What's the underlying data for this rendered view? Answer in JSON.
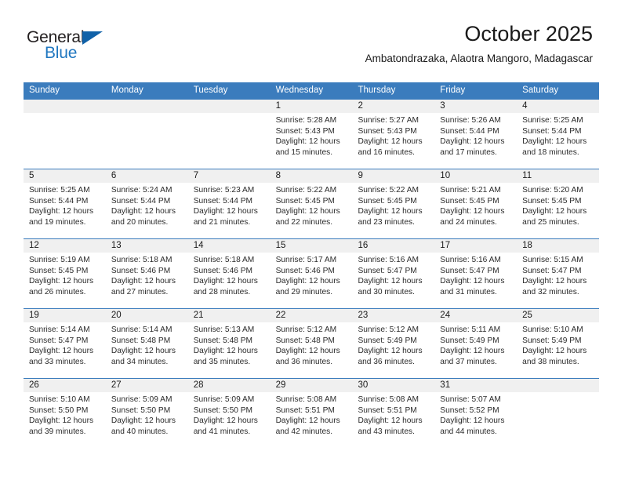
{
  "logo": {
    "word_top": "General",
    "word_bottom": "Blue",
    "triangle_color": "#1061a8",
    "blue_color": "#2077c0"
  },
  "header": {
    "title": "October 2025",
    "subtitle": "Ambatondrazaka, Alaotra Mangoro, Madagascar"
  },
  "theme": {
    "header_blue": "#3b7cbd",
    "daynum_gray": "#f0f0f0"
  },
  "weekdays": [
    "Sunday",
    "Monday",
    "Tuesday",
    "Wednesday",
    "Thursday",
    "Friday",
    "Saturday"
  ],
  "labels": {
    "sunrise": "Sunrise:",
    "sunset": "Sunset:",
    "daylight": "Daylight:"
  },
  "weeks": [
    [
      {
        "day": "",
        "sunrise": "",
        "sunset": "",
        "daylight": ""
      },
      {
        "day": "",
        "sunrise": "",
        "sunset": "",
        "daylight": ""
      },
      {
        "day": "",
        "sunrise": "",
        "sunset": "",
        "daylight": ""
      },
      {
        "day": "1",
        "sunrise": "Sunrise: 5:28 AM",
        "sunset": "Sunset: 5:43 PM",
        "daylight": "Daylight: 12 hours and 15 minutes."
      },
      {
        "day": "2",
        "sunrise": "Sunrise: 5:27 AM",
        "sunset": "Sunset: 5:43 PM",
        "daylight": "Daylight: 12 hours and 16 minutes."
      },
      {
        "day": "3",
        "sunrise": "Sunrise: 5:26 AM",
        "sunset": "Sunset: 5:44 PM",
        "daylight": "Daylight: 12 hours and 17 minutes."
      },
      {
        "day": "4",
        "sunrise": "Sunrise: 5:25 AM",
        "sunset": "Sunset: 5:44 PM",
        "daylight": "Daylight: 12 hours and 18 minutes."
      }
    ],
    [
      {
        "day": "5",
        "sunrise": "Sunrise: 5:25 AM",
        "sunset": "Sunset: 5:44 PM",
        "daylight": "Daylight: 12 hours and 19 minutes."
      },
      {
        "day": "6",
        "sunrise": "Sunrise: 5:24 AM",
        "sunset": "Sunset: 5:44 PM",
        "daylight": "Daylight: 12 hours and 20 minutes."
      },
      {
        "day": "7",
        "sunrise": "Sunrise: 5:23 AM",
        "sunset": "Sunset: 5:44 PM",
        "daylight": "Daylight: 12 hours and 21 minutes."
      },
      {
        "day": "8",
        "sunrise": "Sunrise: 5:22 AM",
        "sunset": "Sunset: 5:45 PM",
        "daylight": "Daylight: 12 hours and 22 minutes."
      },
      {
        "day": "9",
        "sunrise": "Sunrise: 5:22 AM",
        "sunset": "Sunset: 5:45 PM",
        "daylight": "Daylight: 12 hours and 23 minutes."
      },
      {
        "day": "10",
        "sunrise": "Sunrise: 5:21 AM",
        "sunset": "Sunset: 5:45 PM",
        "daylight": "Daylight: 12 hours and 24 minutes."
      },
      {
        "day": "11",
        "sunrise": "Sunrise: 5:20 AM",
        "sunset": "Sunset: 5:45 PM",
        "daylight": "Daylight: 12 hours and 25 minutes."
      }
    ],
    [
      {
        "day": "12",
        "sunrise": "Sunrise: 5:19 AM",
        "sunset": "Sunset: 5:45 PM",
        "daylight": "Daylight: 12 hours and 26 minutes."
      },
      {
        "day": "13",
        "sunrise": "Sunrise: 5:18 AM",
        "sunset": "Sunset: 5:46 PM",
        "daylight": "Daylight: 12 hours and 27 minutes."
      },
      {
        "day": "14",
        "sunrise": "Sunrise: 5:18 AM",
        "sunset": "Sunset: 5:46 PM",
        "daylight": "Daylight: 12 hours and 28 minutes."
      },
      {
        "day": "15",
        "sunrise": "Sunrise: 5:17 AM",
        "sunset": "Sunset: 5:46 PM",
        "daylight": "Daylight: 12 hours and 29 minutes."
      },
      {
        "day": "16",
        "sunrise": "Sunrise: 5:16 AM",
        "sunset": "Sunset: 5:47 PM",
        "daylight": "Daylight: 12 hours and 30 minutes."
      },
      {
        "day": "17",
        "sunrise": "Sunrise: 5:16 AM",
        "sunset": "Sunset: 5:47 PM",
        "daylight": "Daylight: 12 hours and 31 minutes."
      },
      {
        "day": "18",
        "sunrise": "Sunrise: 5:15 AM",
        "sunset": "Sunset: 5:47 PM",
        "daylight": "Daylight: 12 hours and 32 minutes."
      }
    ],
    [
      {
        "day": "19",
        "sunrise": "Sunrise: 5:14 AM",
        "sunset": "Sunset: 5:47 PM",
        "daylight": "Daylight: 12 hours and 33 minutes."
      },
      {
        "day": "20",
        "sunrise": "Sunrise: 5:14 AM",
        "sunset": "Sunset: 5:48 PM",
        "daylight": "Daylight: 12 hours and 34 minutes."
      },
      {
        "day": "21",
        "sunrise": "Sunrise: 5:13 AM",
        "sunset": "Sunset: 5:48 PM",
        "daylight": "Daylight: 12 hours and 35 minutes."
      },
      {
        "day": "22",
        "sunrise": "Sunrise: 5:12 AM",
        "sunset": "Sunset: 5:48 PM",
        "daylight": "Daylight: 12 hours and 36 minutes."
      },
      {
        "day": "23",
        "sunrise": "Sunrise: 5:12 AM",
        "sunset": "Sunset: 5:49 PM",
        "daylight": "Daylight: 12 hours and 36 minutes."
      },
      {
        "day": "24",
        "sunrise": "Sunrise: 5:11 AM",
        "sunset": "Sunset: 5:49 PM",
        "daylight": "Daylight: 12 hours and 37 minutes."
      },
      {
        "day": "25",
        "sunrise": "Sunrise: 5:10 AM",
        "sunset": "Sunset: 5:49 PM",
        "daylight": "Daylight: 12 hours and 38 minutes."
      }
    ],
    [
      {
        "day": "26",
        "sunrise": "Sunrise: 5:10 AM",
        "sunset": "Sunset: 5:50 PM",
        "daylight": "Daylight: 12 hours and 39 minutes."
      },
      {
        "day": "27",
        "sunrise": "Sunrise: 5:09 AM",
        "sunset": "Sunset: 5:50 PM",
        "daylight": "Daylight: 12 hours and 40 minutes."
      },
      {
        "day": "28",
        "sunrise": "Sunrise: 5:09 AM",
        "sunset": "Sunset: 5:50 PM",
        "daylight": "Daylight: 12 hours and 41 minutes."
      },
      {
        "day": "29",
        "sunrise": "Sunrise: 5:08 AM",
        "sunset": "Sunset: 5:51 PM",
        "daylight": "Daylight: 12 hours and 42 minutes."
      },
      {
        "day": "30",
        "sunrise": "Sunrise: 5:08 AM",
        "sunset": "Sunset: 5:51 PM",
        "daylight": "Daylight: 12 hours and 43 minutes."
      },
      {
        "day": "31",
        "sunrise": "Sunrise: 5:07 AM",
        "sunset": "Sunset: 5:52 PM",
        "daylight": "Daylight: 12 hours and 44 minutes."
      },
      {
        "day": "",
        "sunrise": "",
        "sunset": "",
        "daylight": ""
      }
    ]
  ]
}
